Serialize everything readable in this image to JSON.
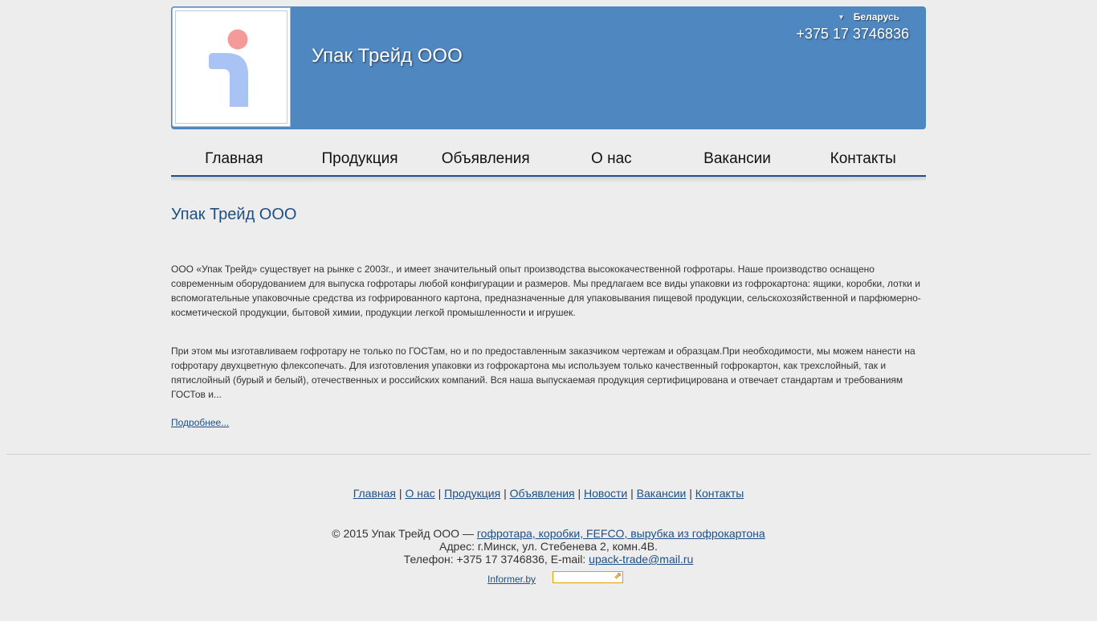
{
  "header": {
    "company_title": "Упак Трейд ООО",
    "region": "Беларусь",
    "phone": "+375 17 3746836",
    "logo_icon": "info-person-icon",
    "colors": {
      "header_bg": "#4f87c1",
      "logo_dot": "#f59a9a",
      "logo_body": "#a9c3f5"
    }
  },
  "nav": {
    "items": [
      {
        "label": "Главная"
      },
      {
        "label": "Продукция"
      },
      {
        "label": "Объявления"
      },
      {
        "label": "О нас"
      },
      {
        "label": "Вакансии"
      },
      {
        "label": "Контакты"
      }
    ]
  },
  "main": {
    "title": "Упак Трейд ООО",
    "paragraph1": "ООО «Упак Трейд» существует на рынке с 2003г., и имеет значительный опыт производства высококачественной гофротары. Наше производство оснащено современным оборудованием для выпуска гофротары любой конфигурации и размеров. Мы предлагаем все виды упаковки из гофрокартона: ящики, коробки, лотки и вспомогательные упаковочные средства из гофрированного картона, предназначенные для упаковывания пищевой продукции, сельскохозяйственной и парфюмерно-косметической продукции, бытовой химии, продукции легкой промышленности и игрушек.",
    "paragraph2": "При этом мы изготавливаем гофротару не только по ГОСТам, но и по предоставленным заказчиком чертежам и образцам.При необходимости, мы можем нанести на гофротару двухцветную флексопечать. Для изготовления упаковки из гофрокартона мы используем только качественный гофрокартон, как трехслойный, так и пятислойный (бурый и белый), отечественных и российских компаний. Вся наша выпускаемая продукция сертифицирована и отвечает стандартам и требованиям ГОСТов и...",
    "more_link": "Подробнее..."
  },
  "footer": {
    "links": [
      {
        "label": "Главная"
      },
      {
        "label": "О нас"
      },
      {
        "label": "Продукция"
      },
      {
        "label": "Объявления"
      },
      {
        "label": "Новости"
      },
      {
        "label": "Вакансии"
      },
      {
        "label": "Контакты"
      }
    ],
    "separator": "|",
    "copyright_prefix": "© 2015 Упак Трейд ООО — ",
    "copyright_link": "гофротара, коробки, FEFCO, вырубка из гофрокартона",
    "address": "Адрес: г.Минск, ул. Стебенева 2, комн.4В.",
    "phone_prefix": "Телефон: +375 17 3746836, E-mail: ",
    "email": "upack-trade@mail.ru",
    "informer_label": "Informer.by"
  }
}
